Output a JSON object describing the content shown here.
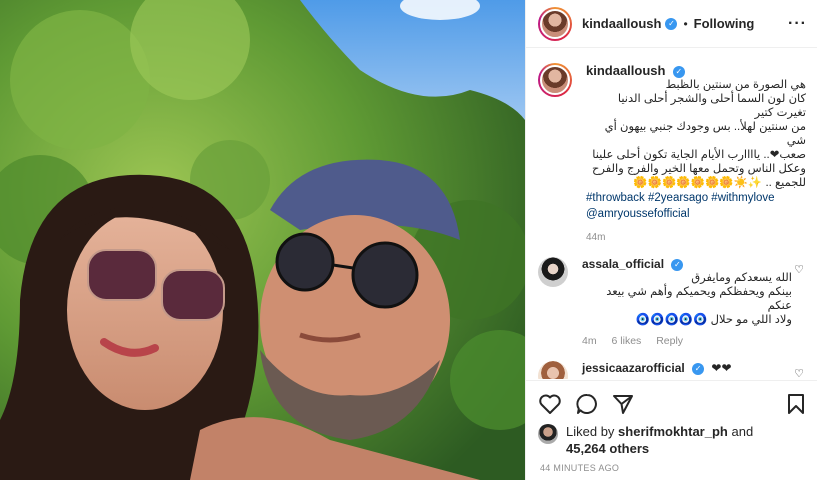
{
  "post": {
    "username": "kindaalloush",
    "follow_status": "Following",
    "more_icon": "more-horizontal-icon",
    "verified_icon": "verified-badge-icon"
  },
  "caption": {
    "username": "kindaalloush",
    "lines": [
      "هي الصورة من سنتين بالظبط",
      "كان لون السما أحلى والشجر أحلى الدنيا تغيرت كتير",
      "من سنتين لهلأ.. بس وجودك جنبي بيهون أي شي",
      "صعب❤.. ياااارب الأيام الجاية تكون أحلى علينا",
      "وعكل الناس وتحمل معها الخير والفرج والفرح",
      "للجميع .. ✨☀️🌼🌼🌼🌼🌼🌼🌼"
    ],
    "hashtags": "#throwback #2yearsago #withmylove",
    "mention": "@amryoussefofficial",
    "time": "44m"
  },
  "comments": [
    {
      "username": "assala_official",
      "lines": [
        "الله يسعدكم ومايفرق",
        "بينكم ويحفظكم ويحميكم وأهم شي بيعد عنكم",
        "ولاد اللي مو حلال 🧿🧿🧿🧿🧿"
      ],
      "time": "4m",
      "likes": "6 likes",
      "reply": "Reply"
    },
    {
      "username": "jessicaazarofficial",
      "text": "❤❤",
      "time": "",
      "likes": "",
      "reply": ""
    }
  ],
  "actions": {
    "like_icon": "heart-outline-icon",
    "comment_icon": "comment-icon",
    "share_icon": "direct-share-icon",
    "save_icon": "bookmark-icon"
  },
  "likes": {
    "prefix": "Liked by",
    "user": "sherifmokhtar_ph",
    "conj": "and",
    "others": "45,264 others"
  },
  "posted": "44 MINUTES AGO",
  "colors": {
    "link": "#00376b",
    "verified": "#3897f0",
    "muted": "#8e8e8e"
  }
}
